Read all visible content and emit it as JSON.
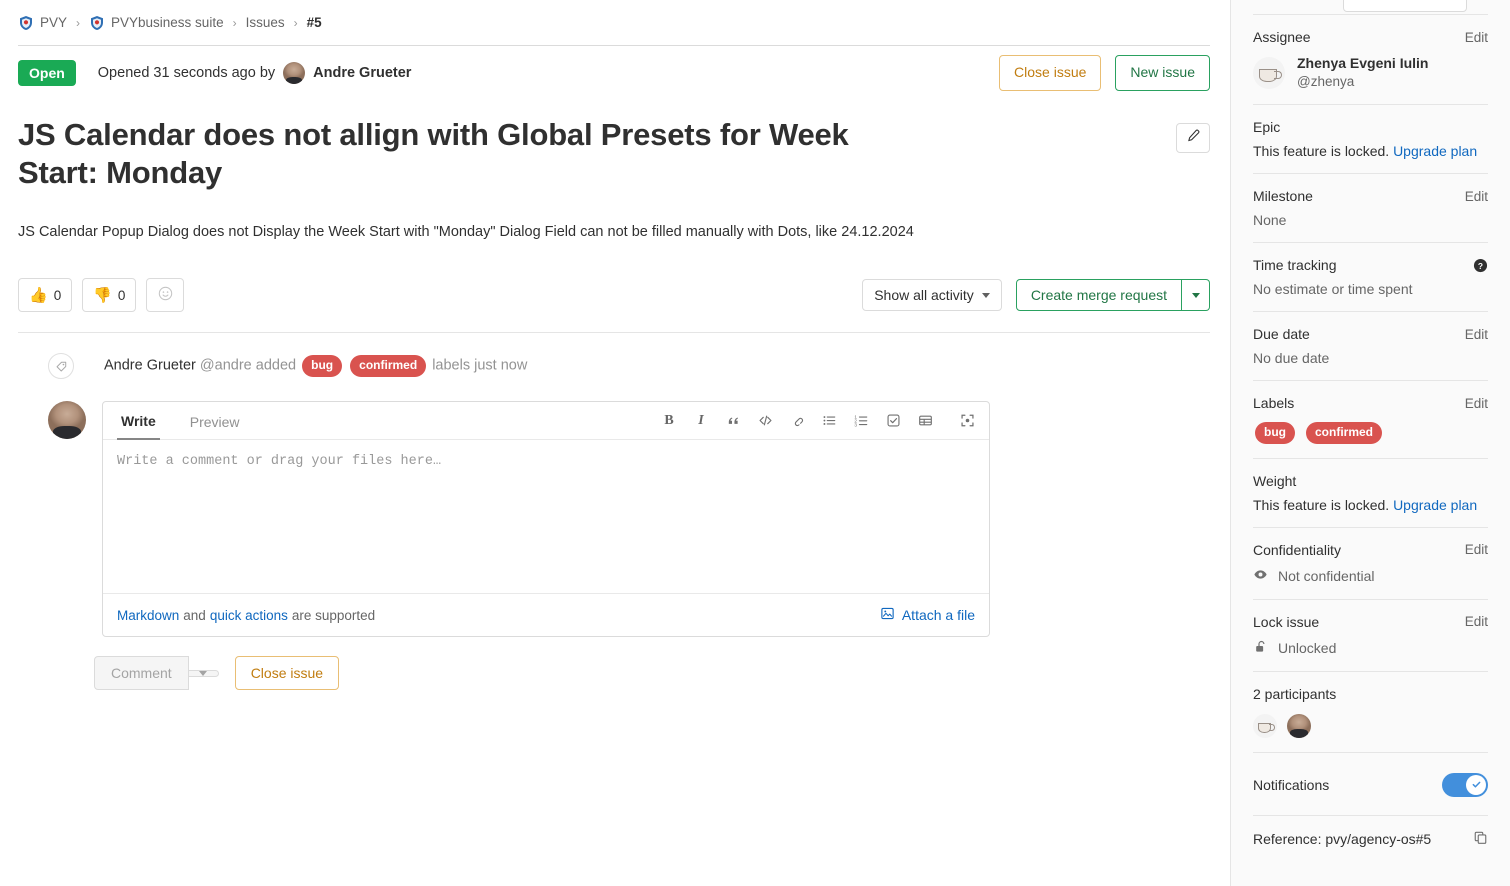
{
  "breadcrumb": {
    "items": [
      {
        "label": "PVY",
        "icon": "shield-icon"
      },
      {
        "label": "PVYbusiness suite",
        "icon": "shield-icon"
      },
      {
        "label": "Issues",
        "icon": null
      },
      {
        "label": "#5",
        "icon": null,
        "current": true
      }
    ],
    "separator": "›"
  },
  "status": {
    "state": "Open",
    "opened_text": "Opened 31 seconds ago by",
    "author": "Andre Grueter",
    "close_button": "Close issue",
    "new_issue_button": "New issue"
  },
  "issue": {
    "title": "JS Calendar does not allign with Global Presets for Week Start: Monday",
    "description": "JS Calendar Popup Dialog does not Display the Week Start with \"Monday\" Dialog Field can not be filled manually with Dots, like 24.12.2024"
  },
  "reactions": {
    "thumbs_up": {
      "emoji": "👍",
      "count": "0"
    },
    "thumbs_down": {
      "emoji": "👎",
      "count": "0"
    },
    "add_reaction": "add-reaction-icon"
  },
  "activity_controls": {
    "filter_label": "Show all activity",
    "merge_request_button": "Create merge request"
  },
  "activity": {
    "icon": "label-tag-icon",
    "author": "Andre Grueter",
    "handle": "@andre",
    "verb": "added",
    "labels": [
      "bug",
      "confirmed"
    ],
    "suffix": "labels",
    "time": "just now"
  },
  "comment_form": {
    "tabs": [
      {
        "label": "Write",
        "active": true
      },
      {
        "label": "Preview",
        "active": false
      }
    ],
    "toolbar": [
      {
        "name": "bold-icon",
        "glyph": "B"
      },
      {
        "name": "italic-icon",
        "glyph": "I"
      },
      {
        "name": "quote-icon",
        "glyph": "❞"
      },
      {
        "name": "code-icon",
        "glyph": "</>"
      },
      {
        "name": "link-icon",
        "glyph": "🔗"
      },
      {
        "name": "bullet-list-icon",
        "glyph": "☰"
      },
      {
        "name": "numbered-list-icon",
        "glyph": "≡"
      },
      {
        "name": "task-list-icon",
        "glyph": "☑"
      },
      {
        "name": "table-icon",
        "glyph": "▤"
      },
      {
        "name": "fullscreen-icon",
        "glyph": "⛶"
      }
    ],
    "placeholder": "Write a comment or drag your files here…",
    "value": "",
    "footer": {
      "markdown_link": "Markdown",
      "and_text": "and",
      "quick_actions_link": "quick actions",
      "supported_text": "are supported",
      "attach_label": "Attach a file"
    },
    "comment_button": "Comment",
    "close_issue_button": "Close issue"
  },
  "sidebar": {
    "assignee": {
      "title": "Assignee",
      "edit": "Edit",
      "name": "Zhenya Evgeni Iulin",
      "handle": "@zhenya"
    },
    "epic": {
      "title": "Epic",
      "locked_text": "This feature is locked.",
      "upgrade_link": "Upgrade plan"
    },
    "milestone": {
      "title": "Milestone",
      "edit": "Edit",
      "value": "None"
    },
    "time_tracking": {
      "title": "Time tracking",
      "help_icon": "help-icon",
      "value": "No estimate or time spent"
    },
    "due_date": {
      "title": "Due date",
      "edit": "Edit",
      "value": "No due date"
    },
    "labels": {
      "title": "Labels",
      "edit": "Edit",
      "items": [
        "bug",
        "confirmed"
      ]
    },
    "weight": {
      "title": "Weight",
      "locked_text": "This feature is locked.",
      "upgrade_link": "Upgrade plan"
    },
    "confidentiality": {
      "title": "Confidentiality",
      "edit": "Edit",
      "value": "Not confidential",
      "icon": "eye-icon"
    },
    "lock_issue": {
      "title": "Lock issue",
      "edit": "Edit",
      "value": "Unlocked",
      "icon": "unlock-icon"
    },
    "participants": {
      "title": "2 participants",
      "avatars": [
        "coffee-avatar",
        "andre-avatar"
      ]
    },
    "notifications": {
      "title": "Notifications",
      "enabled": true
    },
    "reference": {
      "text": "Reference: pvy/agency-os#5",
      "copy_icon": "copy-icon"
    }
  },
  "colors": {
    "state_open": "#1aaa55",
    "label_red": "#d9534f",
    "link_blue": "#1068bf",
    "toggle_blue": "#428fdc",
    "warning_orange": "#c17d10",
    "success_green": "#217645"
  }
}
